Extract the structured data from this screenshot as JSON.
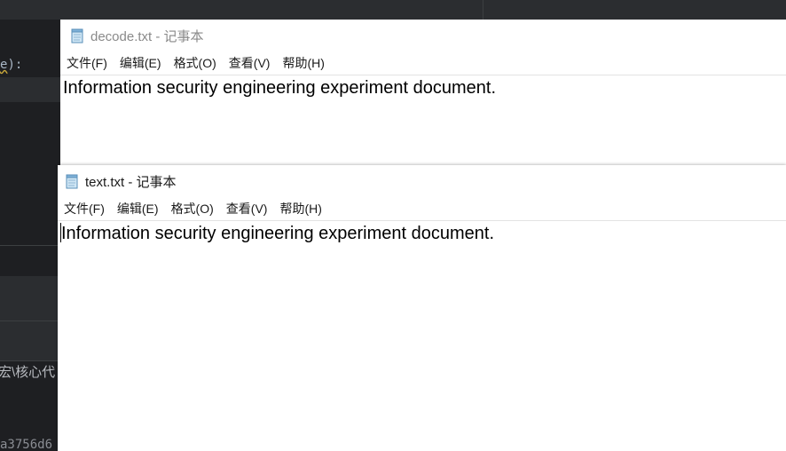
{
  "ide": {
    "code_prefix": "e",
    "code_suffix": "):",
    "path_fragment": "宏\\核心代",
    "hash_fragment": "a3756d6"
  },
  "windows": {
    "back": {
      "title": "decode.txt - 记事本",
      "icon": "notepad-icon",
      "menu": [
        "文件(F)",
        "编辑(E)",
        "格式(O)",
        "查看(V)",
        "帮助(H)"
      ],
      "content": "Information security engineering experiment document."
    },
    "front": {
      "title": "text.txt - 记事本",
      "icon": "notepad-icon",
      "menu": [
        "文件(F)",
        "编辑(E)",
        "格式(O)",
        "查看(V)",
        "帮助(H)"
      ],
      "content": "Information security engineering experiment document."
    }
  }
}
